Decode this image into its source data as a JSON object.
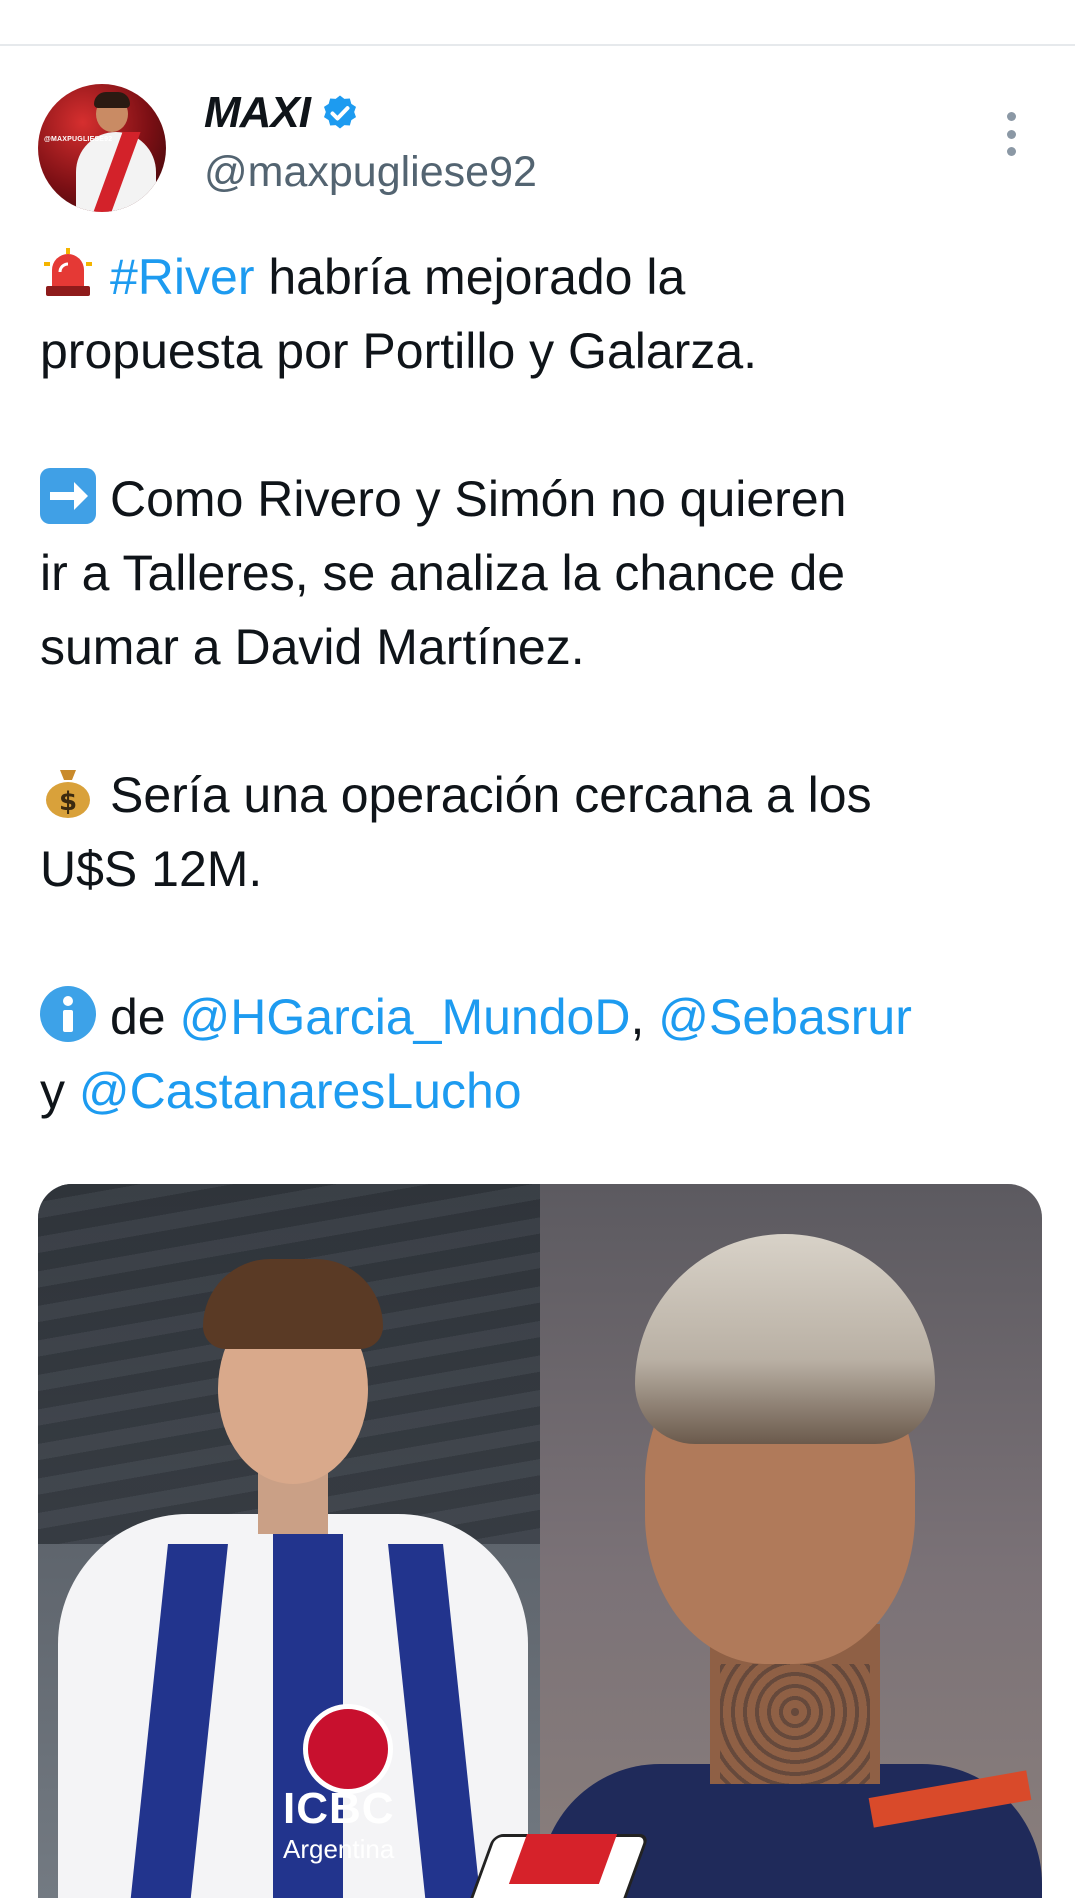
{
  "author": {
    "name": "MAXI",
    "handle": "@maxpugliese92",
    "avatar_tag": "@MAXPUGLIESE92",
    "verified": true
  },
  "tweet": {
    "line1_link": "#River",
    "line1_text": " habría mejorado la",
    "line2_text": "propuesta por Portillo y Galarza.",
    "line3_text": "Como Rivero y Simón no quieren",
    "line4_text": "ir a Talleres, se analiza la chance de",
    "line5_text": "sumar a David Martínez.",
    "line6_text": "Sería una operación cercana a los",
    "line7_text": "U$S 12M.",
    "line8_prefix": "de ",
    "mention1": "@HGarcia_MundoD",
    "comma": ", ",
    "mention2": "@Sebasrur",
    "line9_prefix": "y ",
    "mention3": "@CastanaresLucho"
  },
  "media": {
    "left_sponsor": "ICBC",
    "left_sponsor_sub": "Argentina"
  },
  "colors": {
    "link": "#1d9bf0",
    "handle": "#536471",
    "verified": "#1d9bf0"
  },
  "icons": [
    "siren-emoji",
    "right-arrow-emoji",
    "money-bag-emoji",
    "information-emoji",
    "verified-badge-icon",
    "more-options-icon"
  ]
}
